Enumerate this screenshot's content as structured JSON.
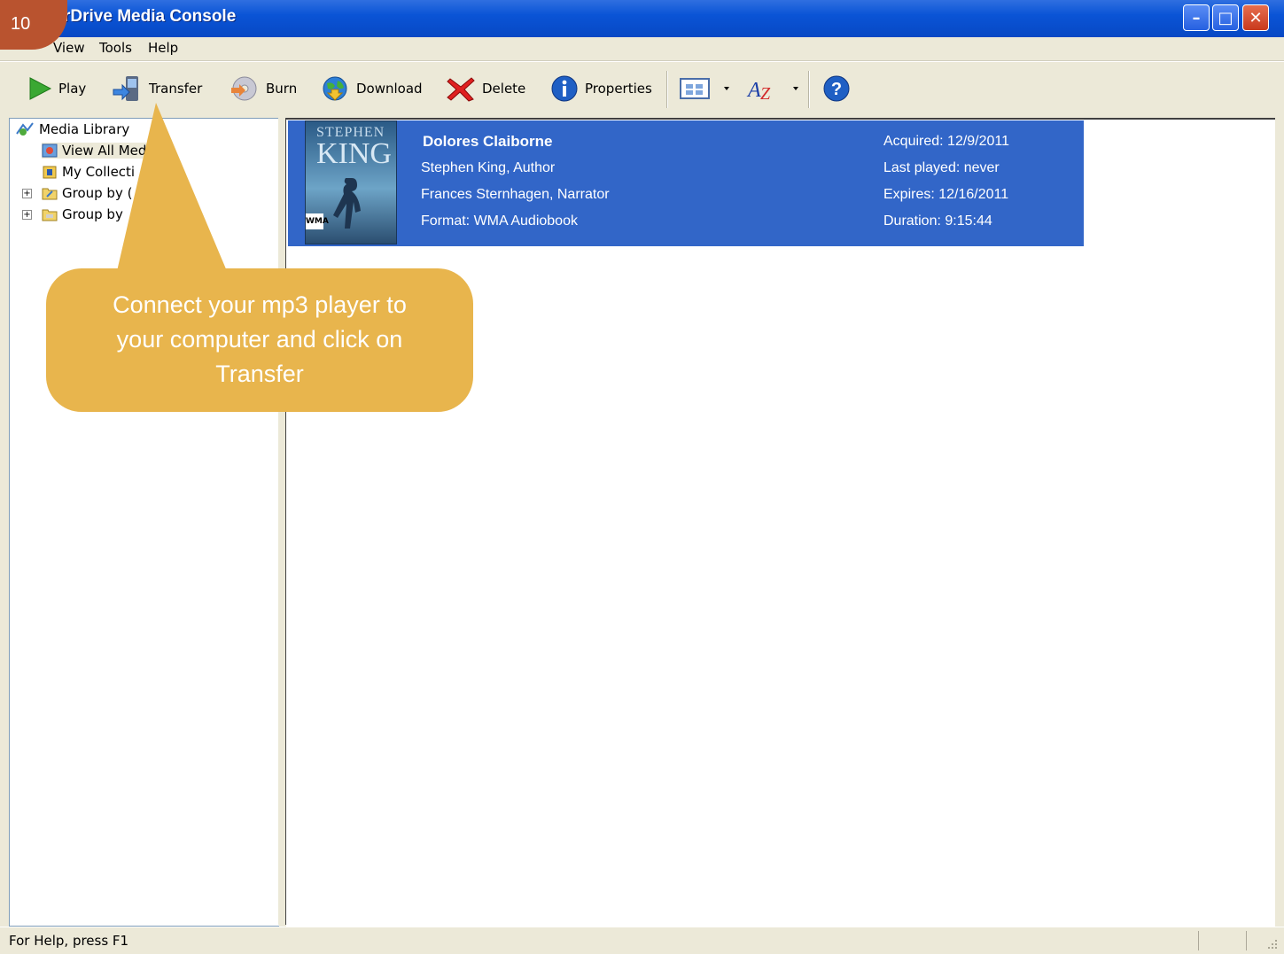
{
  "slide": {
    "number": "10"
  },
  "window": {
    "title": "rDrive Media Console",
    "controls": {
      "minimize": "–",
      "maximize": "□",
      "close": "✕"
    }
  },
  "menu": {
    "items": [
      {
        "label": "View"
      },
      {
        "label": "Tools"
      },
      {
        "label": "Help"
      }
    ]
  },
  "toolbar": {
    "play": {
      "label": "Play",
      "icon": "play-icon"
    },
    "transfer": {
      "label": "Transfer",
      "icon": "transfer-icon"
    },
    "burn": {
      "label": "Burn",
      "icon": "burn-cd-icon"
    },
    "download": {
      "label": "Download",
      "icon": "globe-download-icon"
    },
    "delete": {
      "label": "Delete",
      "icon": "red-x-icon"
    },
    "properties": {
      "label": "Properties",
      "icon": "info-icon"
    },
    "view_icon": "view-grid-icon",
    "sort_icon": "sort-az-icon",
    "help_icon": "help-icon"
  },
  "tree": {
    "root": "Media Library",
    "items": [
      {
        "label": "View All Med"
      },
      {
        "label": "My Collecti"
      },
      {
        "label": "Group by ("
      },
      {
        "label": "Group by"
      }
    ]
  },
  "title_card": {
    "title": "Dolores Claiborne",
    "author": "Stephen King, Author",
    "narrator": "Frances Sternhagen, Narrator",
    "format": "Format: WMA Audiobook",
    "acquired": "Acquired: 12/9/2011",
    "last_played": "Last played: never",
    "expires": "Expires: 12/16/2011",
    "duration": "Duration: 9:15:44",
    "cover": {
      "author_top": "STEPHEN",
      "author_big": "KING",
      "badge": "WMA"
    }
  },
  "statusbar": {
    "text": "For Help, press F1"
  },
  "callout": {
    "lines": [
      "Connect your mp3 player to",
      "your computer and click on",
      "Transfer"
    ],
    "color": "#e8b54d"
  },
  "colors": {
    "titlebar": "#0a54d6",
    "selection": "#3266c8",
    "badge": "#b9532f"
  }
}
